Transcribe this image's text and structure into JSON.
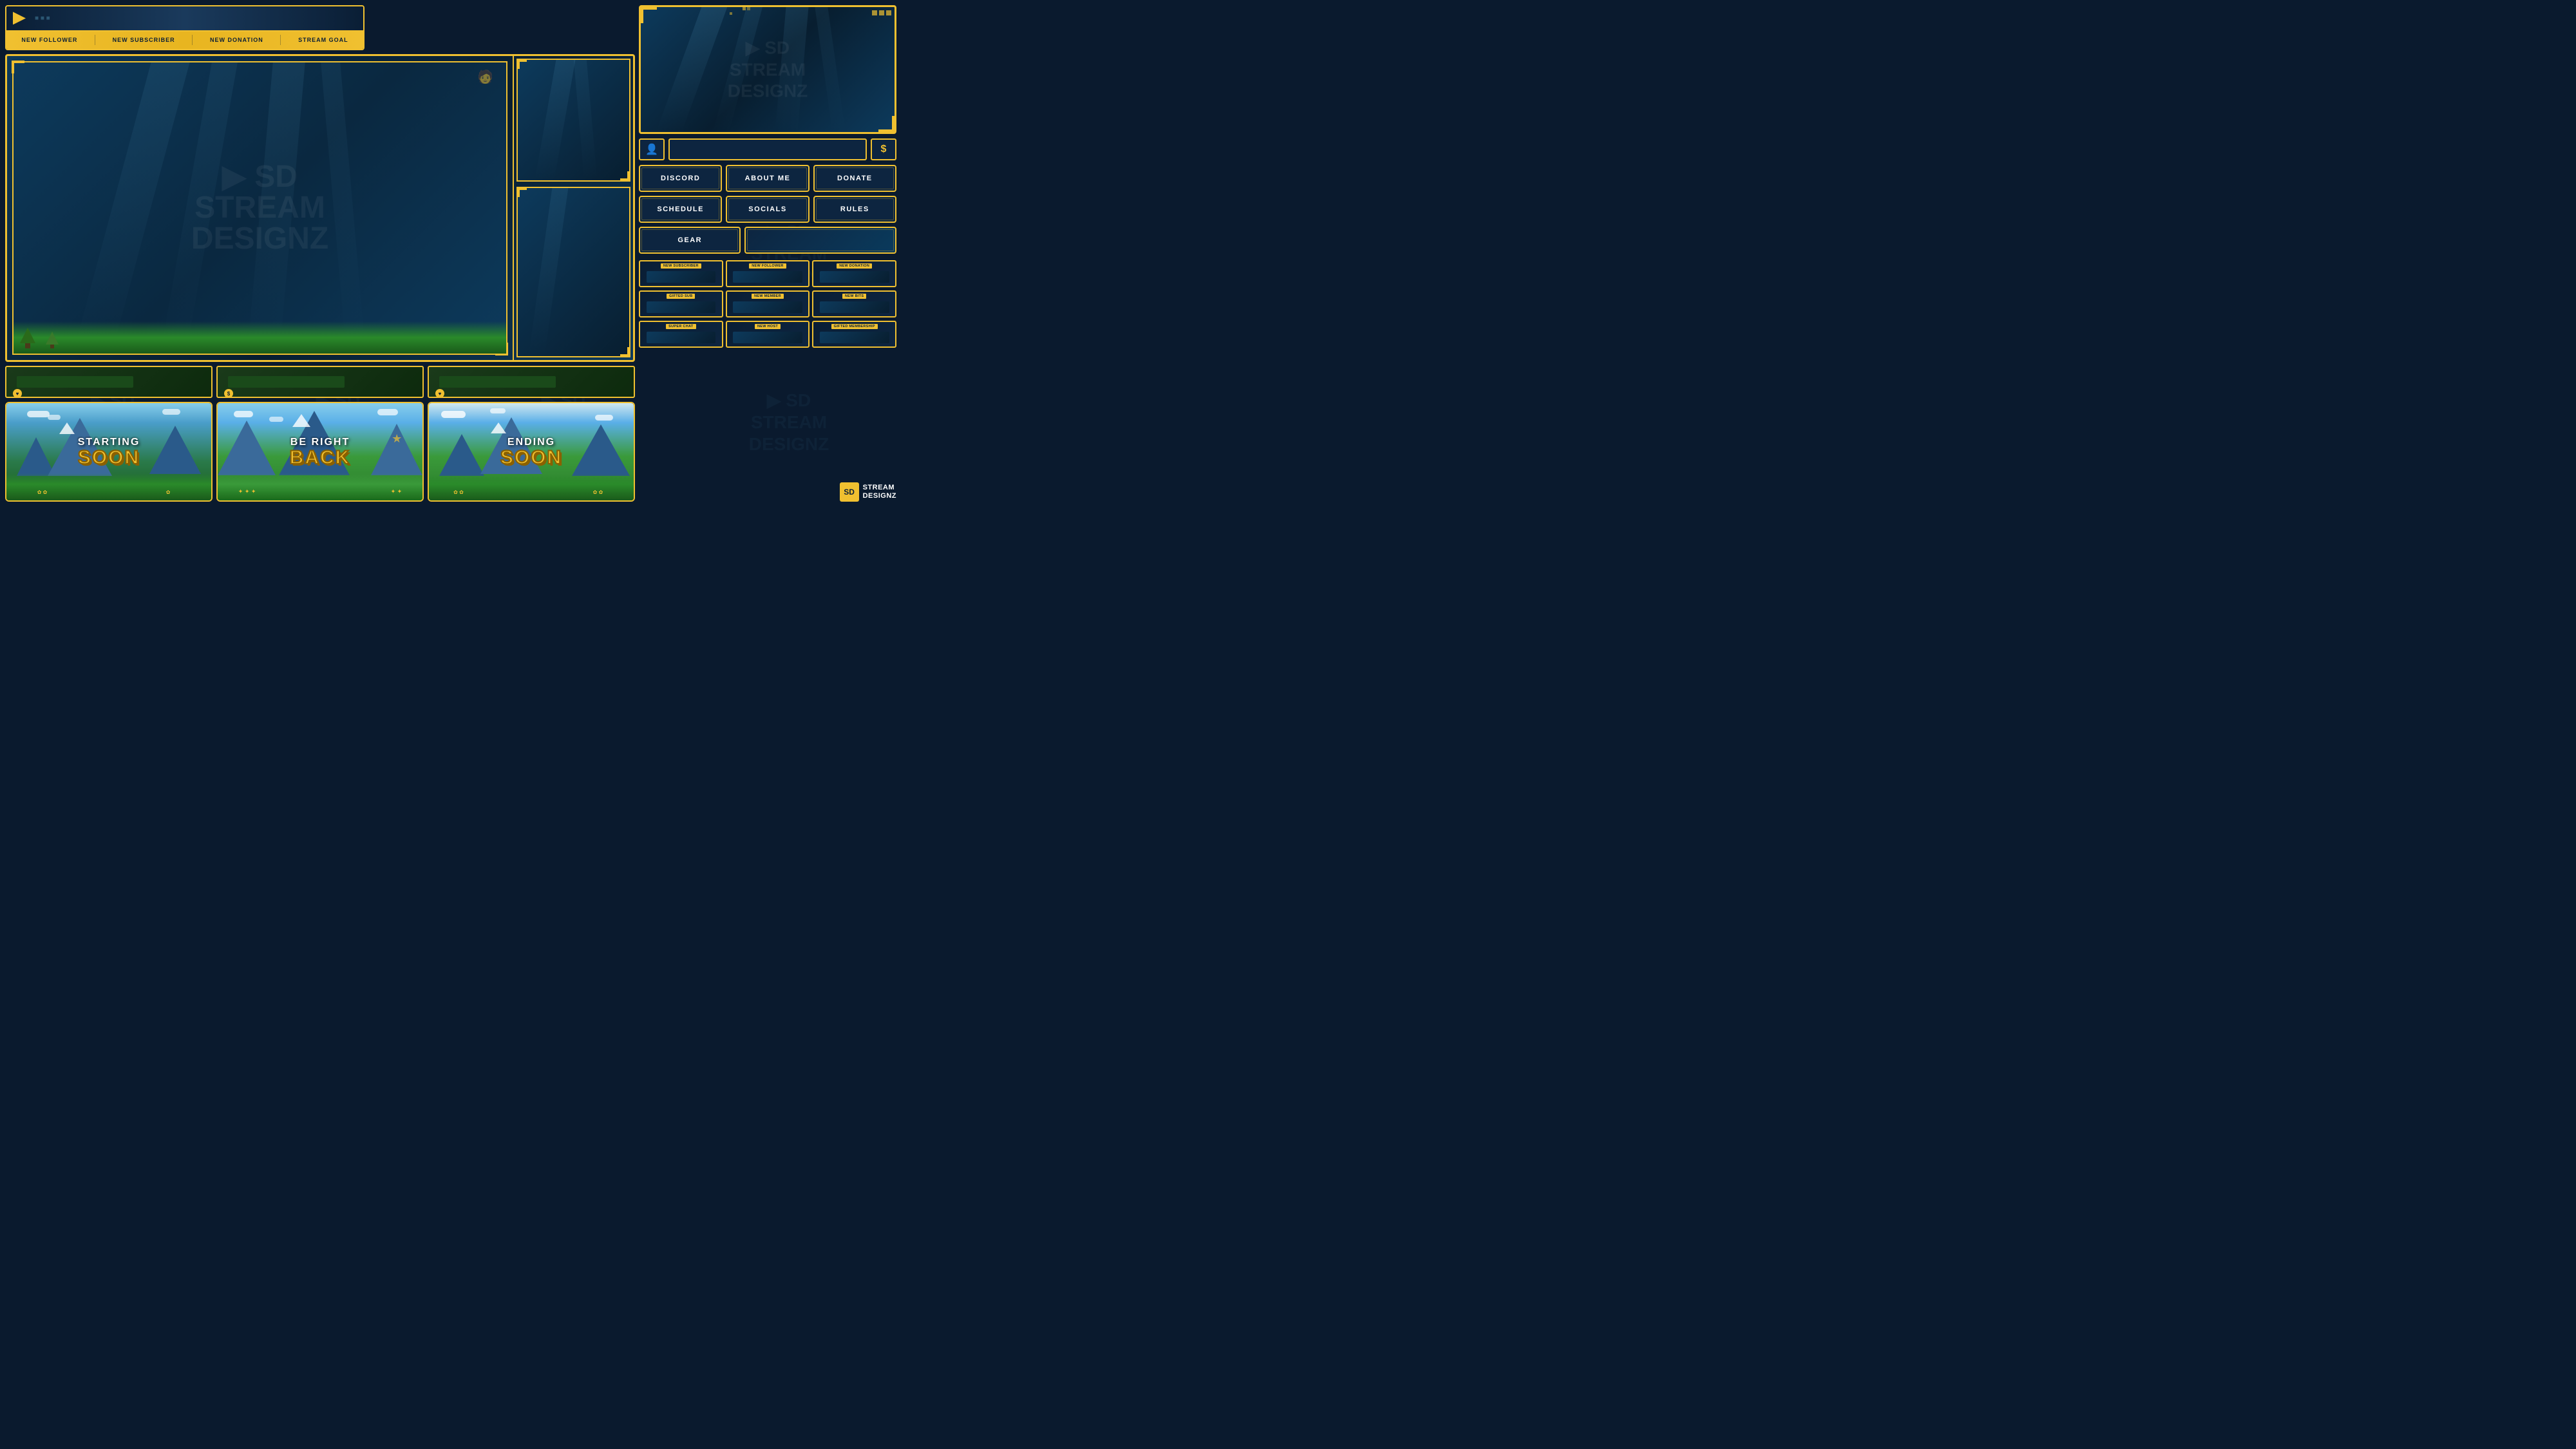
{
  "brand": {
    "name": "SD STREAM DESIGNZ",
    "logo_text": "SD",
    "watermark_text": "SD STREAM\nDESIGNZ"
  },
  "alert_bar": {
    "labels": [
      "NEW FOLLOWER",
      "NEW SUBSCRIBER",
      "NEW DONATION",
      "STREAM GOAL"
    ]
  },
  "nav_buttons": {
    "row1": [
      {
        "id": "discord",
        "label": "DISCORD"
      },
      {
        "id": "about_me",
        "label": "ABOUT ME"
      },
      {
        "id": "donate",
        "label": "DONATE"
      }
    ],
    "row2": [
      {
        "id": "schedule",
        "label": "SCHEDULE"
      },
      {
        "id": "socials",
        "label": "SOCIALS"
      },
      {
        "id": "rules",
        "label": "RULES"
      }
    ],
    "row3": [
      {
        "id": "gear",
        "label": "GEAR"
      },
      {
        "id": "empty",
        "label": ""
      }
    ]
  },
  "alert_panels": {
    "row1": [
      "NEW SUBSCRIBER",
      "NEW FOLLOWER",
      "NEW DONATION"
    ],
    "row2": [
      "GIFTED SUB",
      "NEW MEMBER",
      "NEW BITS"
    ],
    "row3": [
      "SUPER CHAT",
      "NEW HOST",
      "GIFTED MEMBERSHIP"
    ]
  },
  "scenes": [
    {
      "id": "starting_soon",
      "top_text": "STARTING",
      "bottom_text": "SOON"
    },
    {
      "id": "be_right_back",
      "top_text": "BE RIGHT",
      "bottom_text": "BACK"
    },
    {
      "id": "ending_soon",
      "top_text": "ENDING",
      "bottom_text": "SOON"
    }
  ],
  "icons": {
    "profile": "👤",
    "dollar": "$",
    "heart": "♥",
    "play": "▶"
  },
  "colors": {
    "accent": "#f0c030",
    "background": "#0a1a2e",
    "panel_bg": "#0d2540",
    "stream_bg": "#0d3a5c"
  }
}
